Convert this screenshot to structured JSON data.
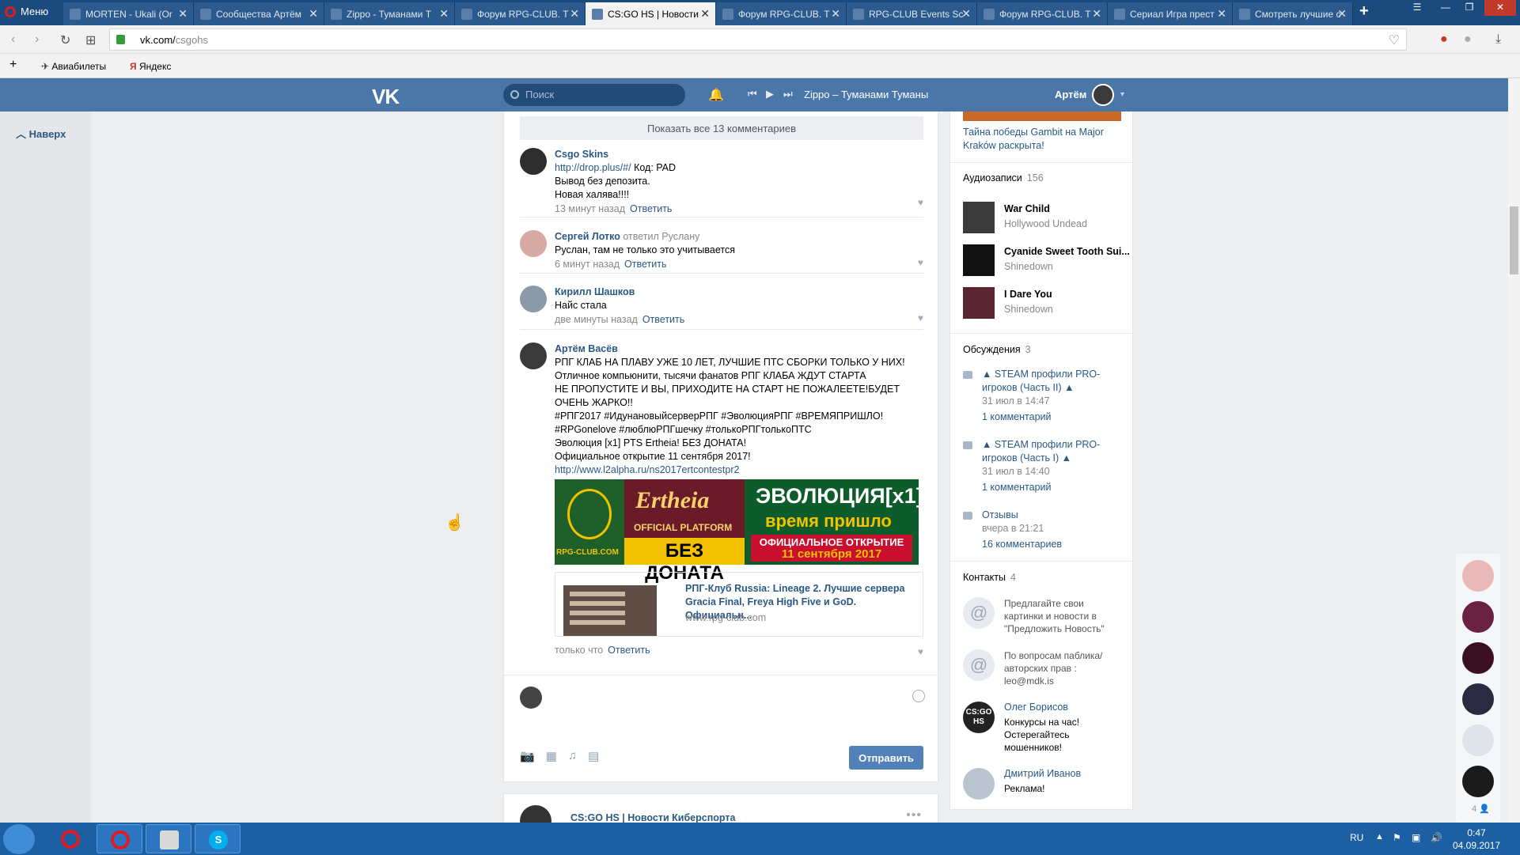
{
  "browser": {
    "menu_label": "Меню",
    "tabs": [
      {
        "label": "MORTEN - Ukali (Or"
      },
      {
        "label": "Сообщества Артём"
      },
      {
        "label": "Zippo - Туманами Т"
      },
      {
        "label": "Форум RPG-CLUB. T"
      },
      {
        "label": "CS:GO HS | Новости"
      },
      {
        "label": "Форум RPG-CLUB. T"
      },
      {
        "label": "RPG-CLUB Events Sc"
      },
      {
        "label": "Форум RPG-CLUB. T"
      },
      {
        "label": "Сериал Игра прест"
      },
      {
        "label": "Смотреть лучшие с"
      }
    ],
    "url_host": "vk.com/",
    "url_path": "csgohs",
    "bookmarks": [
      "Авиабилеты",
      "Яндекс"
    ]
  },
  "header": {
    "logo": "VK",
    "search_placeholder": "Поиск",
    "now_playing": "Zippo – Туманами Туманы",
    "user_name": "Артём"
  },
  "left": {
    "up_label": "Наверх"
  },
  "post": {
    "show_all": "Показать все 13 комментариев",
    "reply_label": "Ответить",
    "comments": [
      {
        "name": "Csgo Skins",
        "reply_to": "",
        "lines": [
          "http://drop.plus/#/ Код: PAD",
          "Вывод без депозита.",
          "Новая халява!!!!"
        ],
        "time": "13 минут назад"
      },
      {
        "name": "Сергей Лотко",
        "reply_to": "ответил Руслану",
        "lines": [
          "Руслан, там не только это учитывается"
        ],
        "time": "6 минут назад"
      },
      {
        "name": "Кирилл Шашков",
        "reply_to": "",
        "lines": [
          "Найс стала"
        ],
        "time": "две минуты назад"
      },
      {
        "name": "Артём Васёв",
        "reply_to": "",
        "lines": [
          "РПГ КЛАБ НА ПЛАВУ УЖЕ 10 ЛЕТ, ЛУЧШИЕ ПТС СБОРКИ ТОЛЬКО У НИХ!",
          "Отличное компьюнити, тысячи фанатов РПГ КЛАБА ЖДУТ СТАРТА",
          "НЕ ПРОПУСТИТЕ И ВЫ, ПРИХОДИТЕ НА СТАРТ НЕ ПОЖАЛЕЕТЕ!БУДЕТ",
          "ОЧЕНЬ ЖАРКО!!"
        ],
        "tags1": "#РПГ2017 #ИдунановыйсерверРПГ #ЭволюцияРПГ #ВРЕМЯПРИШЛО!",
        "tags2": "#RPGonelove #люблюРПГшечку #толькоРПГтолькоПТС",
        "lines2": [
          "Эволюция [x1] PTS Ertheia! БЕЗ ДОНАТА!",
          "Официальное открытие 11 сентября 2017!"
        ],
        "link": "http://www.l2alpha.ru/ns2017ertcontestpr2",
        "time": "только что"
      }
    ],
    "banner": {
      "logo_text": "RPG-CLUB.COM",
      "ertheia": "Ertheia",
      "official": "OFFICIAL PLATFORM",
      "no_donate": "БЕЗ ДОНАТА",
      "evolution": "ЭВОЛЮЦИЯ[x1]",
      "time_come": "время пришло",
      "opening": "ОФИЦИАЛЬНОЕ ОТКРЫТИЕ",
      "opening_date": "11 сентября 2017"
    },
    "link_card": {
      "title": "РПГ-Клуб Russia: Lineage 2. Лучшие сервера Gracia Final, Freya High Five и GoD. Официальн...",
      "domain": "www.rpg-club.com"
    },
    "send_label": "Отправить",
    "next_post_author": "CS:GO HS | Новости Киберспорта"
  },
  "right": {
    "top_text": "Тайна победы Gambit на Major Kraków раскрыта!",
    "audio_header": "Аудиозаписи",
    "audio_count": "156",
    "audio": [
      {
        "title": "War Child",
        "artist": "Hollywood Undead"
      },
      {
        "title": "Cyanide Sweet Tooth Sui...",
        "artist": "Shinedown"
      },
      {
        "title": "I Dare You",
        "artist": "Shinedown"
      }
    ],
    "disc_header": "Обсуждения",
    "disc_count": "3",
    "discussions": [
      {
        "title": "▲ STEAM профили PRO-игроков (Часть II) ▲",
        "date": "31 июл в 14:47",
        "comments": "1 комментарий"
      },
      {
        "title": "▲ STEAM профили PRO-игроков (Часть I) ▲",
        "date": "31 июл в 14:40",
        "comments": "1 комментарий"
      },
      {
        "title": "Отзывы",
        "date": "вчера в 21:21",
        "comments": "16 комментариев"
      }
    ],
    "contacts_header": "Контакты",
    "contacts_count": "4",
    "contacts": [
      {
        "name": "",
        "desc": "Предлагайте свои картинки и новости в \"Предложить Новость\""
      },
      {
        "name": "",
        "desc": "По вопросам паблика/ авторских прав : leo@mdk.is"
      },
      {
        "name": "Олег Борисов",
        "desc": "Конкурсы на час! Остерегайтесь мошенников!"
      },
      {
        "name": "Дмитрий Иванов",
        "desc": "Реклама!"
      }
    ]
  },
  "chats": {
    "count": "4"
  },
  "taskbar": {
    "lang": "RU",
    "time": "0:47",
    "date": "04.09.2017"
  }
}
